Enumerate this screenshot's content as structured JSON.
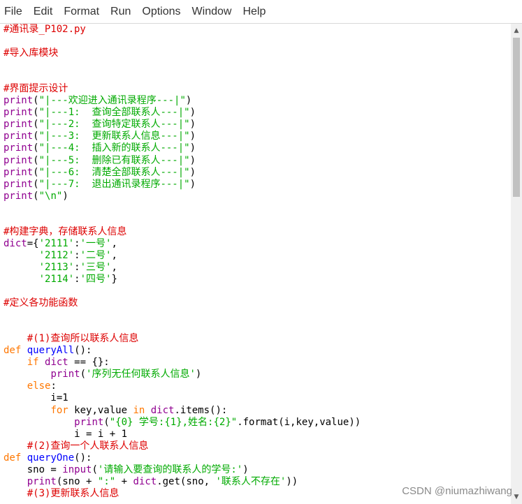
{
  "menu": [
    "File",
    "Edit",
    "Format",
    "Run",
    "Options",
    "Window",
    "Help"
  ],
  "code_lines": [
    [
      {
        "t": "#通讯录_P102.py",
        "c": "c"
      }
    ],
    [],
    [
      {
        "t": "#导入库模块",
        "c": "c"
      }
    ],
    [],
    [],
    [
      {
        "t": "#界面提示设计",
        "c": "c"
      }
    ],
    [
      {
        "t": "print",
        "c": "b"
      },
      {
        "t": "(",
        "c": ""
      },
      {
        "t": "\"|---欢迎进入通讯录程序---|\"",
        "c": "s"
      },
      {
        "t": ")",
        "c": ""
      }
    ],
    [
      {
        "t": "print",
        "c": "b"
      },
      {
        "t": "(",
        "c": ""
      },
      {
        "t": "\"|---1:  查询全部联系人---|\"",
        "c": "s"
      },
      {
        "t": ")",
        "c": ""
      }
    ],
    [
      {
        "t": "print",
        "c": "b"
      },
      {
        "t": "(",
        "c": ""
      },
      {
        "t": "\"|---2:  查询特定联系人---|\"",
        "c": "s"
      },
      {
        "t": ")",
        "c": ""
      }
    ],
    [
      {
        "t": "print",
        "c": "b"
      },
      {
        "t": "(",
        "c": ""
      },
      {
        "t": "\"|---3:  更新联系人信息---|\"",
        "c": "s"
      },
      {
        "t": ")",
        "c": ""
      }
    ],
    [
      {
        "t": "print",
        "c": "b"
      },
      {
        "t": "(",
        "c": ""
      },
      {
        "t": "\"|---4:  插入新的联系人---|\"",
        "c": "s"
      },
      {
        "t": ")",
        "c": ""
      }
    ],
    [
      {
        "t": "print",
        "c": "b"
      },
      {
        "t": "(",
        "c": ""
      },
      {
        "t": "\"|---5:  删除已有联系人---|\"",
        "c": "s"
      },
      {
        "t": ")",
        "c": ""
      }
    ],
    [
      {
        "t": "print",
        "c": "b"
      },
      {
        "t": "(",
        "c": ""
      },
      {
        "t": "\"|---6:  清楚全部联系人---|\"",
        "c": "s"
      },
      {
        "t": ")",
        "c": ""
      }
    ],
    [
      {
        "t": "print",
        "c": "b"
      },
      {
        "t": "(",
        "c": ""
      },
      {
        "t": "\"|---7:  退出通讯录程序---|\"",
        "c": "s"
      },
      {
        "t": ")",
        "c": ""
      }
    ],
    [
      {
        "t": "print",
        "c": "b"
      },
      {
        "t": "(",
        "c": ""
      },
      {
        "t": "\"\\n\"",
        "c": "s"
      },
      {
        "t": ")",
        "c": ""
      }
    ],
    [],
    [],
    [
      {
        "t": "#构建字典，存储联系人信息",
        "c": "c"
      }
    ],
    [
      {
        "t": "dict",
        "c": "b"
      },
      {
        "t": "={",
        "c": ""
      },
      {
        "t": "'2111'",
        "c": "s"
      },
      {
        "t": ":",
        "c": ""
      },
      {
        "t": "'一号'",
        "c": "s"
      },
      {
        "t": ",",
        "c": ""
      }
    ],
    [
      {
        "t": "      ",
        "c": ""
      },
      {
        "t": "'2112'",
        "c": "s"
      },
      {
        "t": ":",
        "c": ""
      },
      {
        "t": "'二号'",
        "c": "s"
      },
      {
        "t": ",",
        "c": ""
      }
    ],
    [
      {
        "t": "      ",
        "c": ""
      },
      {
        "t": "'2113'",
        "c": "s"
      },
      {
        "t": ":",
        "c": ""
      },
      {
        "t": "'三号'",
        "c": "s"
      },
      {
        "t": ",",
        "c": ""
      }
    ],
    [
      {
        "t": "      ",
        "c": ""
      },
      {
        "t": "'2114'",
        "c": "s"
      },
      {
        "t": ":",
        "c": ""
      },
      {
        "t": "'四号'",
        "c": "s"
      },
      {
        "t": "}",
        "c": ""
      }
    ],
    [],
    [
      {
        "t": "#定义各功能函数",
        "c": "c"
      }
    ],
    [],
    [],
    [
      {
        "t": "    #(1)查询所以联系人信息",
        "c": "c"
      }
    ],
    [
      {
        "t": "def",
        "c": "k"
      },
      {
        "t": " ",
        "c": ""
      },
      {
        "t": "queryAll",
        "c": "d"
      },
      {
        "t": "():",
        "c": ""
      }
    ],
    [
      {
        "t": "    ",
        "c": ""
      },
      {
        "t": "if",
        "c": "k"
      },
      {
        "t": " ",
        "c": ""
      },
      {
        "t": "dict",
        "c": "b"
      },
      {
        "t": " == {}:",
        "c": ""
      }
    ],
    [
      {
        "t": "        ",
        "c": ""
      },
      {
        "t": "print",
        "c": "b"
      },
      {
        "t": "(",
        "c": ""
      },
      {
        "t": "'序列无任何联系人信息'",
        "c": "s"
      },
      {
        "t": ")",
        "c": ""
      }
    ],
    [
      {
        "t": "    ",
        "c": ""
      },
      {
        "t": "else",
        "c": "k"
      },
      {
        "t": ":",
        "c": ""
      }
    ],
    [
      {
        "t": "        i=1",
        "c": ""
      }
    ],
    [
      {
        "t": "        ",
        "c": ""
      },
      {
        "t": "for",
        "c": "k"
      },
      {
        "t": " key,value ",
        "c": ""
      },
      {
        "t": "in",
        "c": "k"
      },
      {
        "t": " ",
        "c": ""
      },
      {
        "t": "dict",
        "c": "b"
      },
      {
        "t": ".items():",
        "c": ""
      }
    ],
    [
      {
        "t": "            ",
        "c": ""
      },
      {
        "t": "print",
        "c": "b"
      },
      {
        "t": "(",
        "c": ""
      },
      {
        "t": "\"{0} 学号:{1},姓名:{2}\"",
        "c": "s"
      },
      {
        "t": ".format(i,key,value))",
        "c": ""
      }
    ],
    [
      {
        "t": "            i = i + 1",
        "c": ""
      }
    ],
    [
      {
        "t": "    #(2)查询一个人联系人信息",
        "c": "c"
      }
    ],
    [
      {
        "t": "def",
        "c": "k"
      },
      {
        "t": " ",
        "c": ""
      },
      {
        "t": "queryOne",
        "c": "d"
      },
      {
        "t": "():",
        "c": ""
      }
    ],
    [
      {
        "t": "    sno = ",
        "c": ""
      },
      {
        "t": "input",
        "c": "b"
      },
      {
        "t": "(",
        "c": ""
      },
      {
        "t": "'请输入要查询的联系人的学号:'",
        "c": "s"
      },
      {
        "t": ")",
        "c": ""
      }
    ],
    [
      {
        "t": "    ",
        "c": ""
      },
      {
        "t": "print",
        "c": "b"
      },
      {
        "t": "(sno + ",
        "c": ""
      },
      {
        "t": "\":\"",
        "c": "s"
      },
      {
        "t": " + ",
        "c": ""
      },
      {
        "t": "dict",
        "c": "b"
      },
      {
        "t": ".get(sno, ",
        "c": ""
      },
      {
        "t": "'联系人不存在'",
        "c": "s"
      },
      {
        "t": "))",
        "c": ""
      }
    ],
    [
      {
        "t": "    #(3)更新联系人信息",
        "c": "c"
      }
    ]
  ],
  "watermark": "CSDN @niumazhiwang",
  "colors": {
    "comment": "#dd0000",
    "keyword": "#ff7700",
    "builtin": "#900090",
    "string": "#00aa00",
    "definition": "#0000ff"
  }
}
